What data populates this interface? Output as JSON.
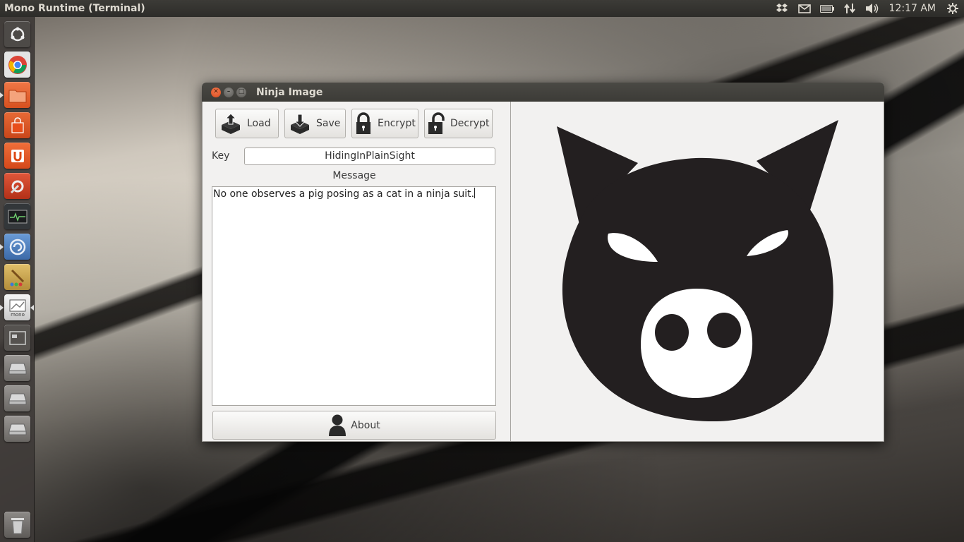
{
  "top_panel": {
    "app_title": "Mono Runtime (Terminal)",
    "clock": "12:17 AM",
    "indicators": [
      "dropbox-icon",
      "mail-icon",
      "battery-icon",
      "network-icon",
      "volume-icon",
      "gear-icon"
    ]
  },
  "launcher": {
    "items": [
      {
        "name": "dash-home",
        "color": "#5a5652"
      },
      {
        "name": "chrome",
        "color": "#e8e8e8"
      },
      {
        "name": "files",
        "color": "#e0632a"
      },
      {
        "name": "software-center",
        "color": "#d95a23"
      },
      {
        "name": "ubuntu-one",
        "color": "#e0632a"
      },
      {
        "name": "system-settings",
        "color": "#c4402a"
      },
      {
        "name": "system-monitor",
        "color": "#3a3d40"
      },
      {
        "name": "monodevelop",
        "color": "#4a7ab8"
      },
      {
        "name": "paint-app",
        "color": "#c8a24a"
      },
      {
        "name": "mono-runtime",
        "color": "#dcdcdc"
      },
      {
        "name": "workspace-switcher",
        "color": "#5b5855"
      },
      {
        "name": "drive-1",
        "color": "#8a8784"
      },
      {
        "name": "drive-2",
        "color": "#8a8784"
      },
      {
        "name": "drive-3",
        "color": "#8a8784"
      }
    ],
    "trash": "trash"
  },
  "window": {
    "title": "Ninja Image",
    "toolbar": {
      "load_label": "Load",
      "save_label": "Save",
      "encrypt_label": "Encrypt",
      "decrypt_label": "Decrypt"
    },
    "key_label": "Key",
    "key_value": "HidingInPlainSight",
    "message_label": "Message",
    "message_text": "No one observes a pig posing as a cat in a ninja suit.",
    "about_label": "About"
  },
  "colors": {
    "accent": "#dd4814",
    "panel_bg": "#3c3b37",
    "window_bg": "#f2f1f0",
    "pig_fill": "#231f20"
  }
}
